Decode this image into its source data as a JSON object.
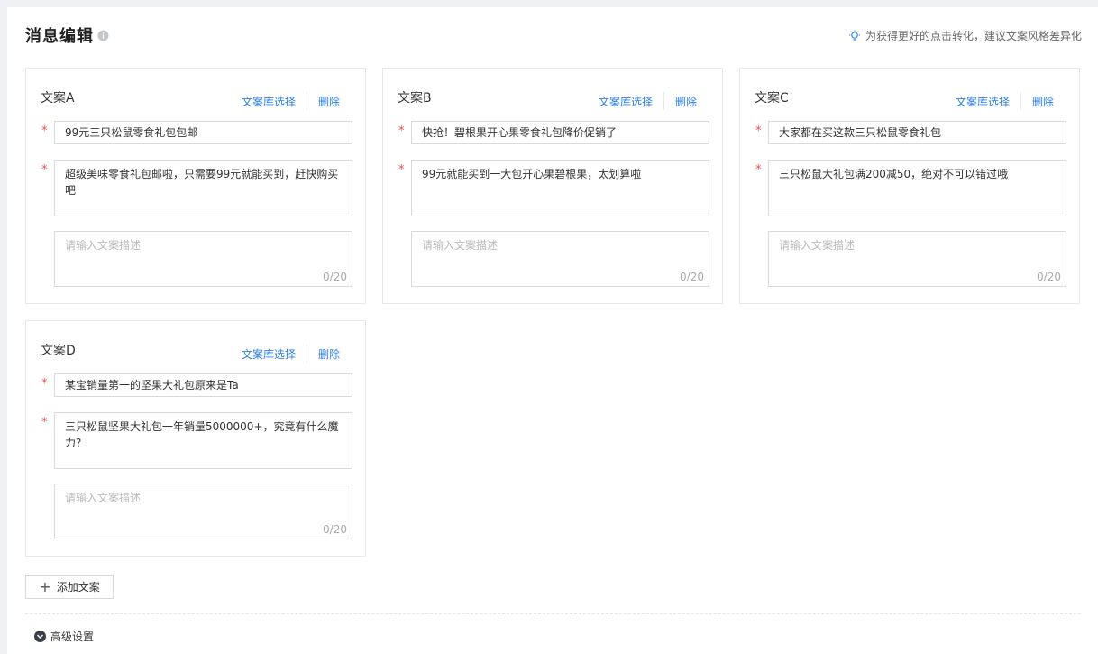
{
  "header": {
    "title": "消息编辑",
    "tip": "为获得更好的点击转化，建议文案风格差异化"
  },
  "cards": [
    {
      "title": "文案A",
      "library_label": "文案库选择",
      "delete_label": "删除",
      "headline": "99元三只松鼠零食礼包包邮",
      "body": "超级美味零食礼包邮啦，只需要99元就能买到，赶快购买吧",
      "desc_placeholder": "请输入文案描述",
      "desc_counter": "0/20"
    },
    {
      "title": "文案B",
      "library_label": "文案库选择",
      "delete_label": "删除",
      "headline": "快抢！碧根果开心果零食礼包降价促销了",
      "body": "99元就能买到一大包开心果碧根果，太划算啦",
      "desc_placeholder": "请输入文案描述",
      "desc_counter": "0/20"
    },
    {
      "title": "文案C",
      "library_label": "文案库选择",
      "delete_label": "删除",
      "headline": "大家都在买这款三只松鼠零食礼包",
      "body": "三只松鼠大礼包满200减50，绝对不可以错过哦",
      "desc_placeholder": "请输入文案描述",
      "desc_counter": "0/20"
    },
    {
      "title": "文案D",
      "library_label": "文案库选择",
      "delete_label": "删除",
      "headline": "某宝销量第一的坚果大礼包原来是Ta",
      "body": "三只松鼠坚果大礼包一年销量5000000+，究竟有什么魔力?",
      "desc_placeholder": "请输入文案描述",
      "desc_counter": "0/20"
    }
  ],
  "add_button_label": "添加文案",
  "advanced_label": "高级设置",
  "colors": {
    "link": "#2f7fe0",
    "required": "#f04a4a"
  }
}
